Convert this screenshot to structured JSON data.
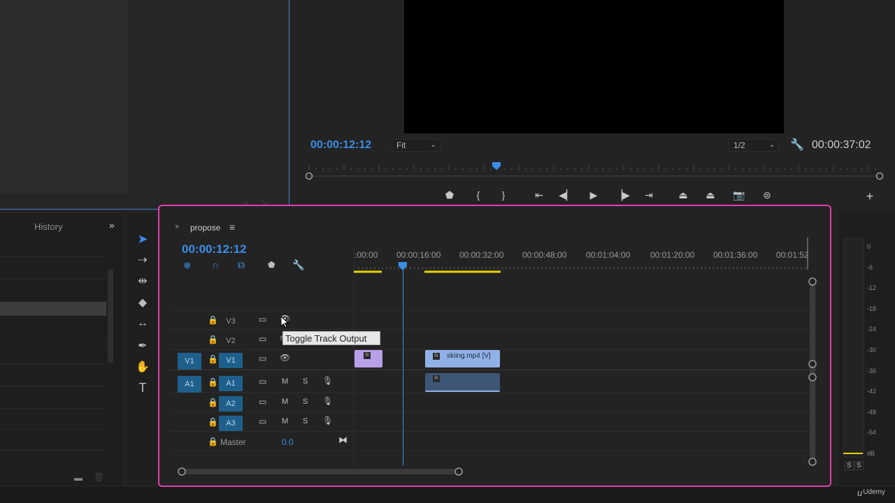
{
  "source_monitor": {},
  "program_monitor": {
    "playhead_timecode": "00:00:12:12",
    "fit_dropdown": "Fit",
    "resolution_dropdown": "1/2",
    "duration_timecode": "00:00:37:02"
  },
  "project_panel": {
    "tab_label": "History",
    "expand_icon": "double-chevron-right"
  },
  "tools": [
    "selection-tool",
    "track-select-tool",
    "ripple-edit-tool",
    "razor-tool",
    "slip-tool",
    "pen-tool",
    "hand-tool",
    "type-tool"
  ],
  "timeline": {
    "close_label": "×",
    "sequence_name": "propose",
    "menu_icon": "≡",
    "timecode": "00:00:12:12",
    "ruler_labels": [
      ":00:00",
      "00:00:16:00",
      "00:00:32:00",
      "00:00:48:00",
      "00:01:04:00",
      "00:01:20:00",
      "00:01:36:00",
      "00:01:52"
    ],
    "tracks": {
      "v3": "V3",
      "v2": "V2",
      "v1": "V1",
      "v1_src": "V1",
      "a1": "A1",
      "a1_src": "A1",
      "a2": "A2",
      "a3": "A3",
      "mute": "M",
      "solo": "S"
    },
    "master_label": "Master",
    "master_value": "0.0",
    "clip_name": "skiing.mp4 [V]",
    "fx_label": "fx",
    "tooltip": "Toggle Track Output"
  },
  "audio_meter": {
    "labels": [
      "0",
      "-6",
      "-12",
      "-18",
      "-24",
      "-30",
      "-36",
      "-42",
      "-48",
      "-54",
      "dB"
    ],
    "solo_left": "S",
    "solo_right": "S"
  },
  "watermark": "Udemy",
  "colors": {
    "accent_blue": "#3a8ee6",
    "highlight_pink": "#e03fae",
    "clip_blue": "#8fb1e6",
    "clip_purple": "#b8a0e8",
    "work_area_yellow": "#e8d400"
  }
}
